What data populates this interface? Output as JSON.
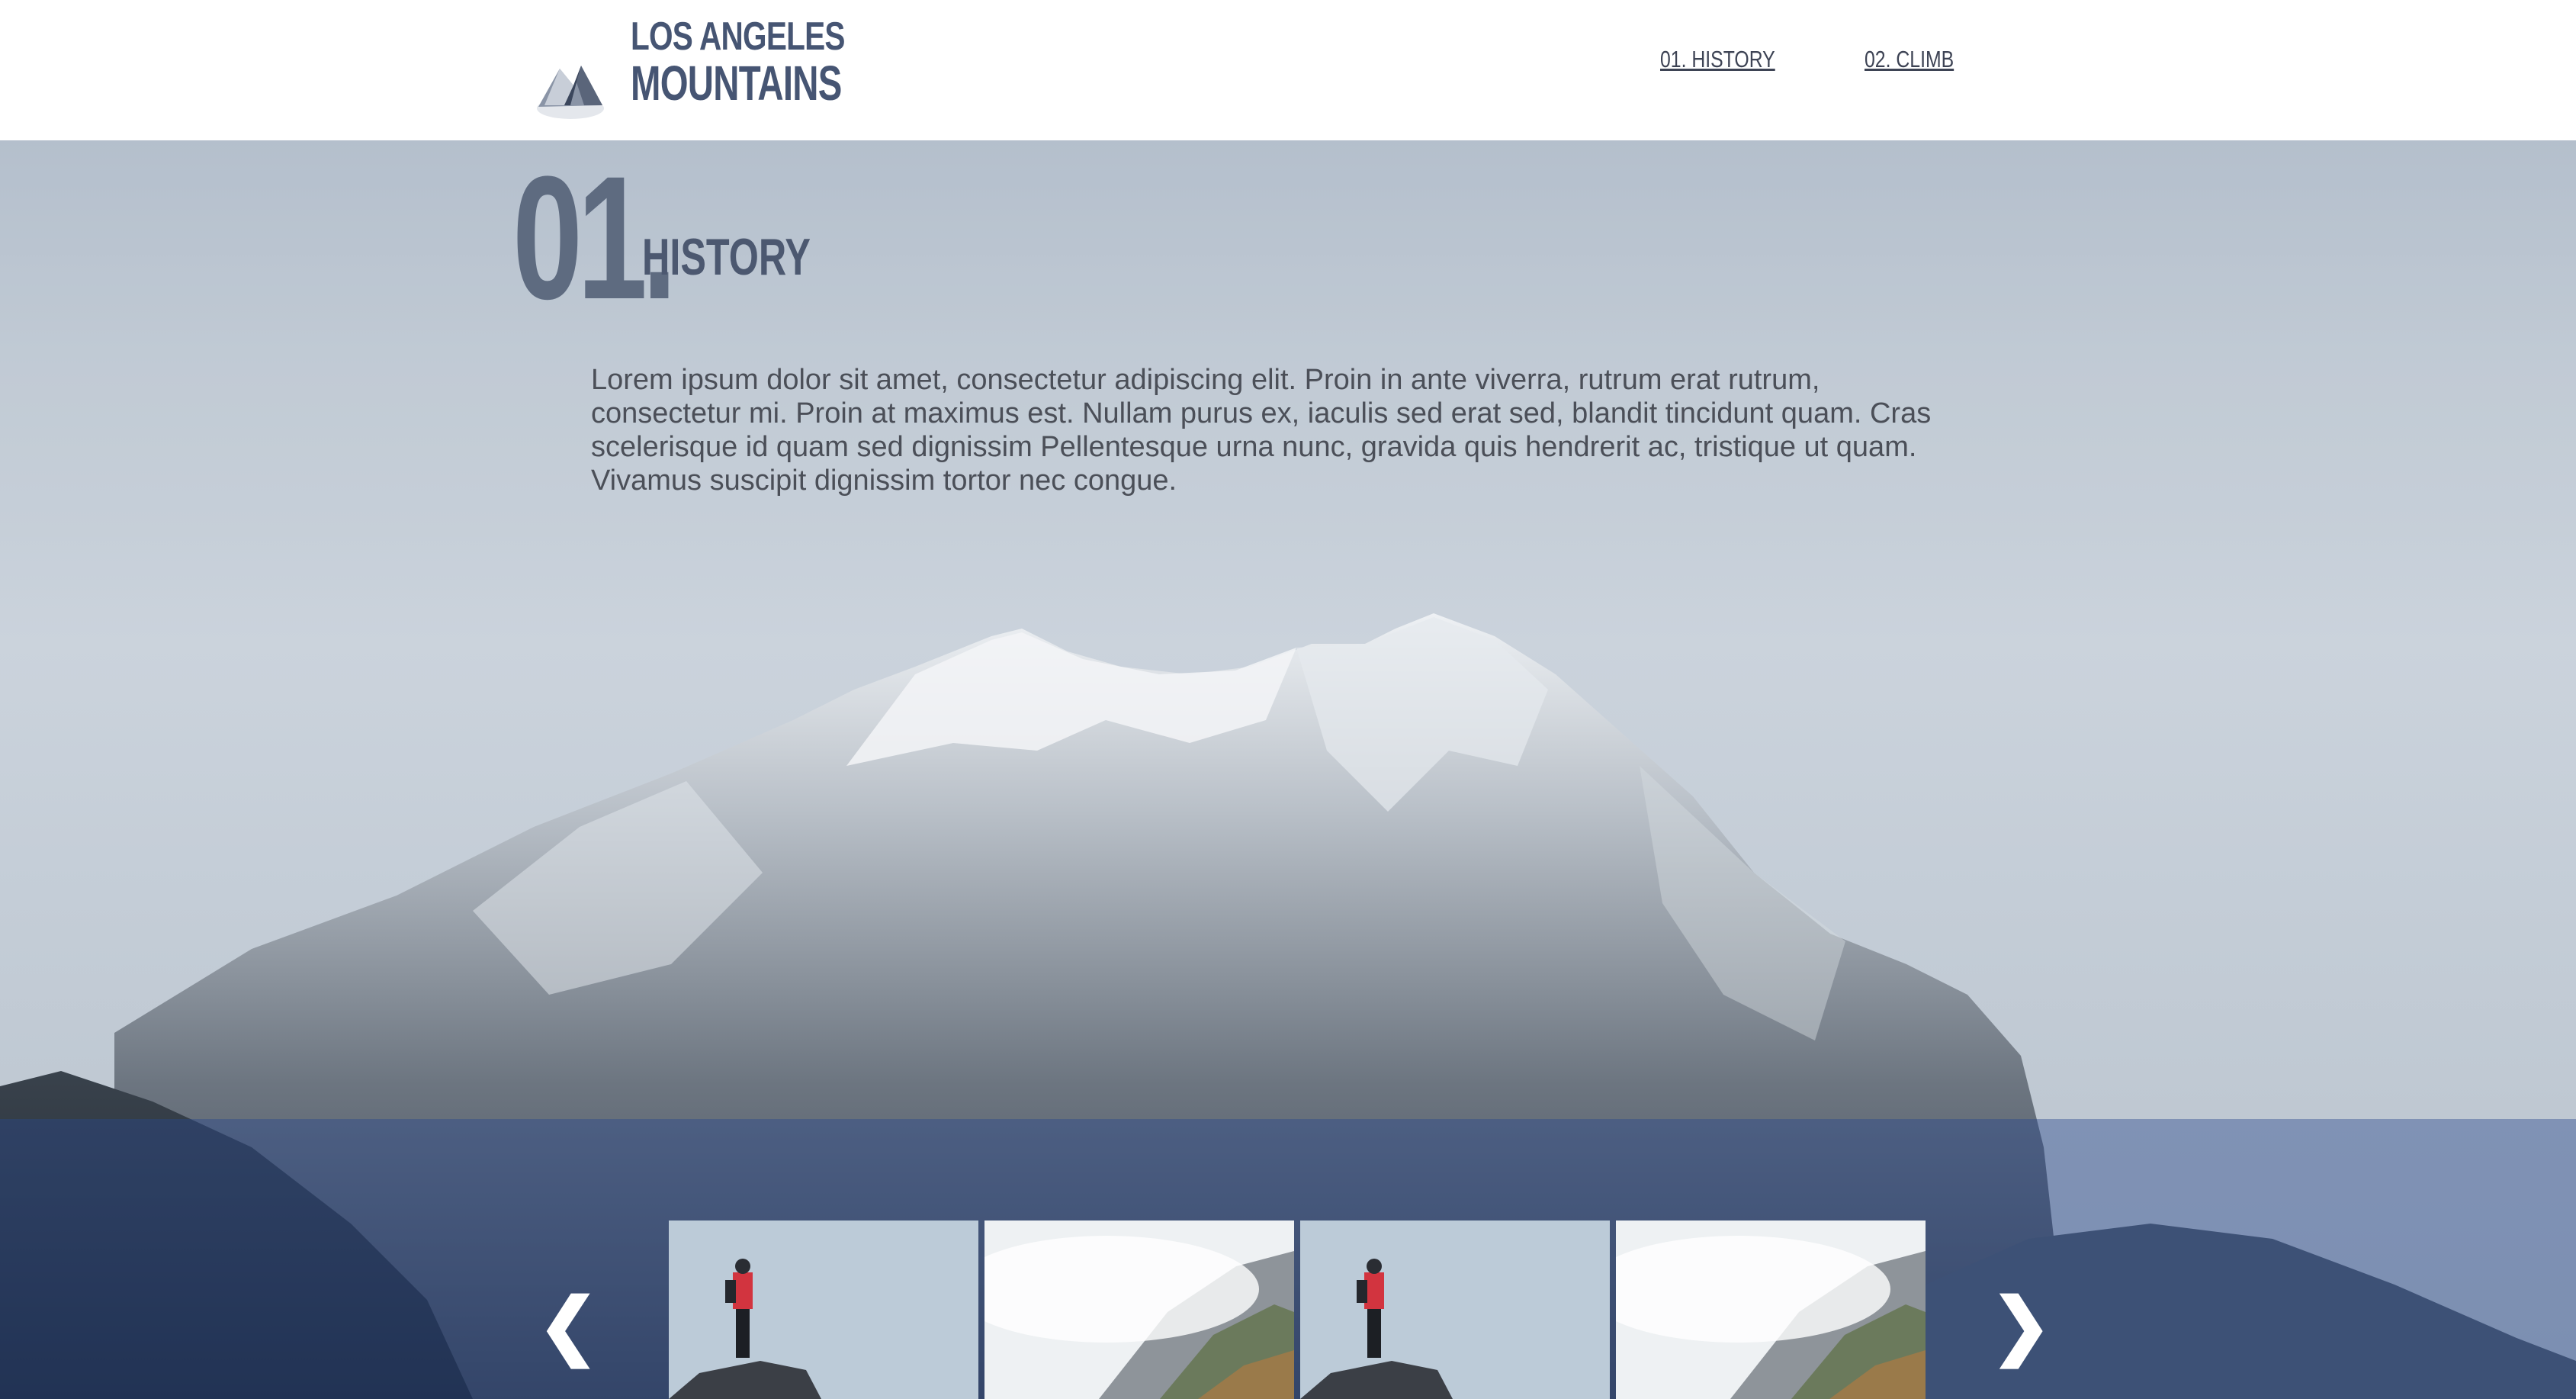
{
  "header": {
    "logo_line1": "LOS ANGELES",
    "logo_line2": "MOUNTAINS",
    "logo_icon": "mountain-icon",
    "nav": [
      {
        "label": "01. HISTORY"
      },
      {
        "label": "02. CLIMB"
      }
    ]
  },
  "section": {
    "number": "01.",
    "title": "HISTORY",
    "body": "Lorem ipsum dolor sit amet, consectetur adipiscing elit. Proin in ante viverra, rutrum erat rutrum, consectetur mi. Proin at maximus est. Nullam purus ex, iaculis sed erat sed, blandit tincidunt quam. Cras scelerisque id quam sed dignissim Pellentesque urna nunc, gravida quis hendrerit ac, tristique ut quam. Vivamus suscipit dignissim tortor nec congue."
  },
  "gallery": {
    "prev_glyph": "❮",
    "next_glyph": "❯",
    "prev_icon": "chevron-left-icon",
    "next_icon": "chevron-right-icon",
    "thumbnails": [
      "hiker-on-rock",
      "misty-mountain",
      "hiker-on-rock",
      "misty-mountain"
    ]
  },
  "colors": {
    "brand": "#465573",
    "strip_overlay": "#28488c",
    "text": "#4b4f58"
  }
}
